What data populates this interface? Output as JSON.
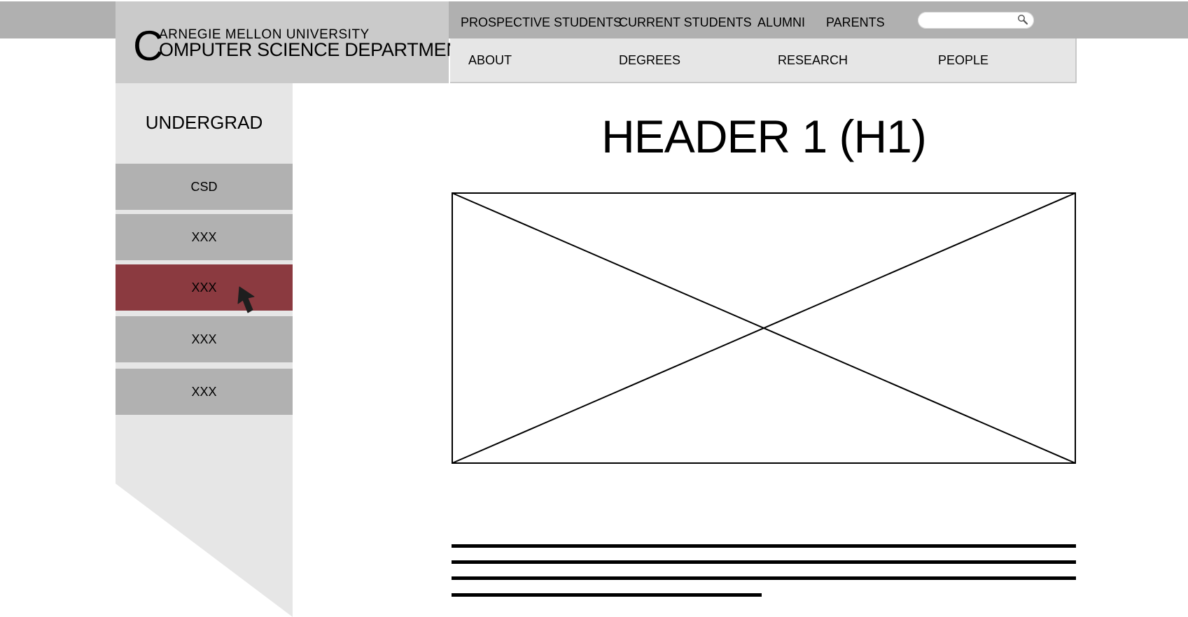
{
  "branding": {
    "logo_initial": "C",
    "university": "ARNEGIE MELLON UNIVERSITY",
    "department": "OMPUTER SCIENCE DEPARTMENT"
  },
  "utility_nav": {
    "items": [
      "PROSPECTIVE STUDENTS",
      "CURRENT STUDENTS",
      "ALUMNI",
      "PARENTS"
    ],
    "search_placeholder": "",
    "search_icon": "search-icon"
  },
  "main_nav": {
    "items": [
      "ABOUT",
      "DEGREES",
      "RESEARCH",
      "PEOPLE"
    ]
  },
  "sidebar": {
    "title": "UNDERGRAD",
    "items": [
      {
        "label": "CSD",
        "active": false
      },
      {
        "label": "XXX",
        "active": false
      },
      {
        "label": "XXX",
        "active": true
      },
      {
        "label": "XXX",
        "active": false
      },
      {
        "label": "XXX",
        "active": false
      }
    ]
  },
  "content": {
    "heading": "HEADER 1 (H1)",
    "image_placeholder": "image-placeholder-icon",
    "body_text_lines": 4
  },
  "colors": {
    "top_strip": "#b0b0b0",
    "logo_block": "#cacaca",
    "nav_background": "#e6e6e6",
    "sidebar_item": "#b1b1b1",
    "sidebar_active": "#8b3a40"
  }
}
